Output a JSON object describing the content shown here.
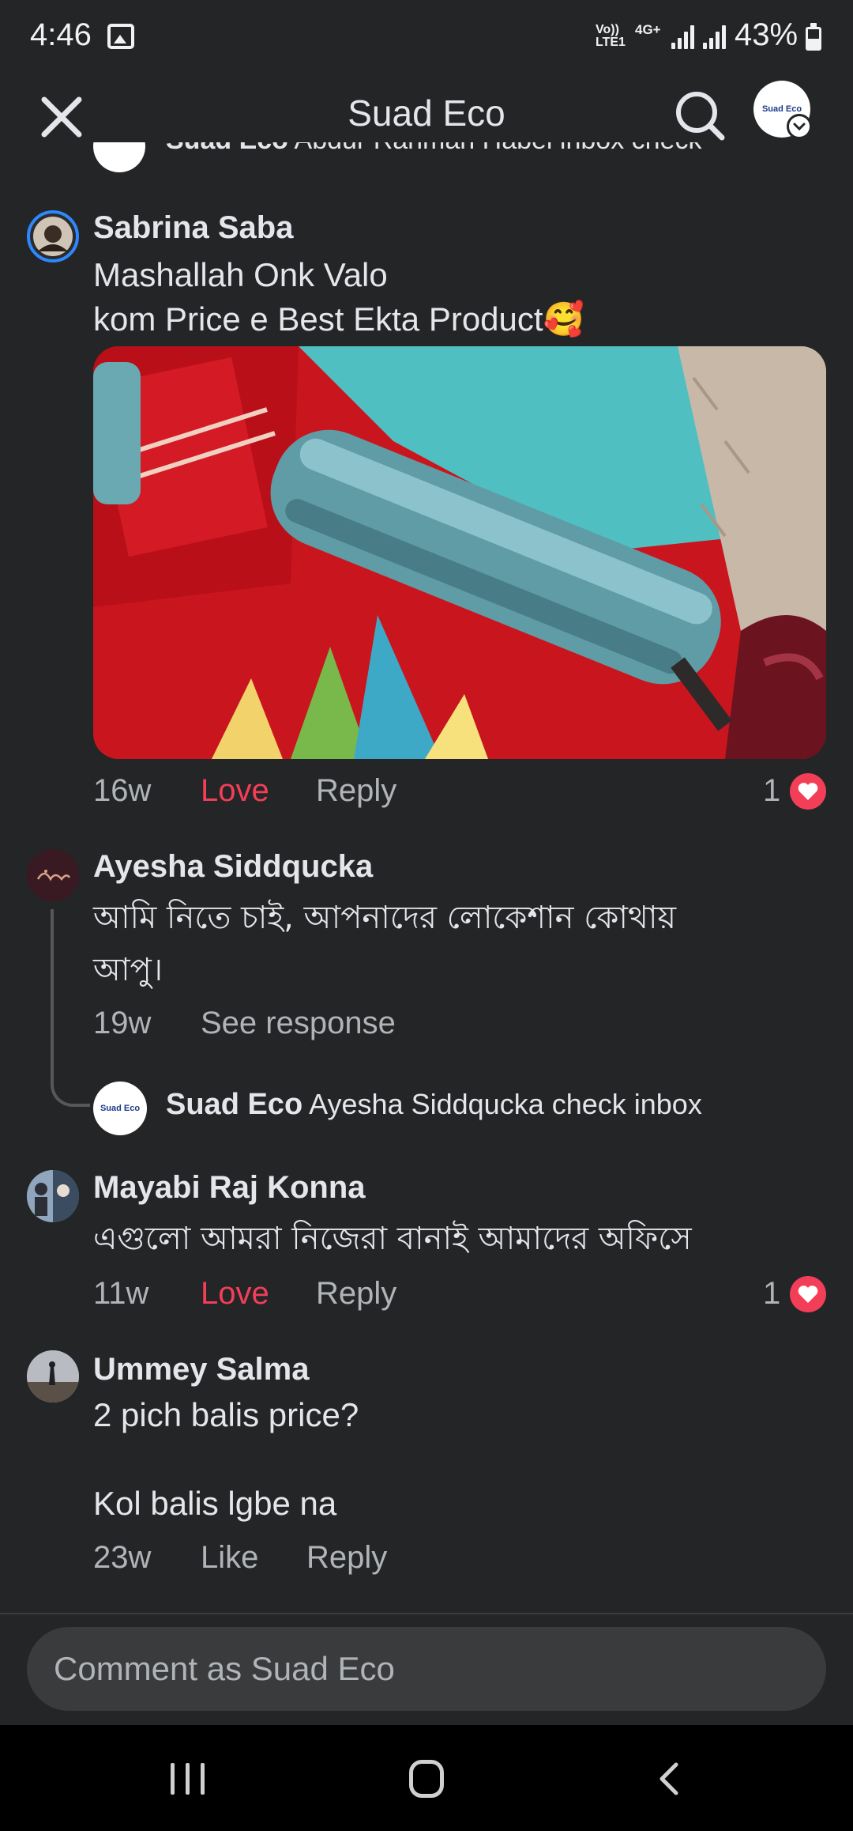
{
  "status_bar": {
    "time": "4:46",
    "network_volte": "Vo)) LTE1",
    "network_4g": "4G+",
    "battery": "43%"
  },
  "header": {
    "title": "Suad Eco",
    "avatar_text": "Suad Eco"
  },
  "partial_comment": {
    "name": "Suad Eco",
    "text": "Abdur Rahman Habel inbox check"
  },
  "comments": [
    {
      "name": "Sabrina Saba",
      "line1": "Mashallah Onk Valo",
      "line2": "kom Price e Best Ekta Product",
      "emoji": "🥰",
      "time": "16w",
      "reaction_label": "Love",
      "reply_label": "Reply",
      "reaction_count": "1"
    },
    {
      "name": "Ayesha Siddqucka",
      "line1": "আমি নিতে চাই, আপনাদের লোকেশান কোথায়",
      "line2": "আপু।",
      "time": "19w",
      "see_response_label": "See response",
      "reply": {
        "avatar_text": "Suad Eco",
        "name": "Suad Eco",
        "text": "Ayesha Siddqucka check inbox"
      }
    },
    {
      "name": "Mayabi Raj Konna",
      "line1": "এগুলো আমরা নিজেরা বানাই আমাদের অফিসে",
      "time": "11w",
      "reaction_label": "Love",
      "reply_label": "Reply",
      "reaction_count": "1"
    },
    {
      "name": "Ummey Salma",
      "line1": "2 pich balis price?",
      "line2": "Kol balis lgbe na",
      "time": "23w",
      "like_label": "Like",
      "reply_label": "Reply"
    }
  ],
  "composer": {
    "placeholder": "Comment as Suad Eco"
  },
  "colors": {
    "background": "#242526",
    "love": "#f33e58",
    "secondary_text": "#b0b3b8",
    "input_bg": "#3a3b3c"
  }
}
